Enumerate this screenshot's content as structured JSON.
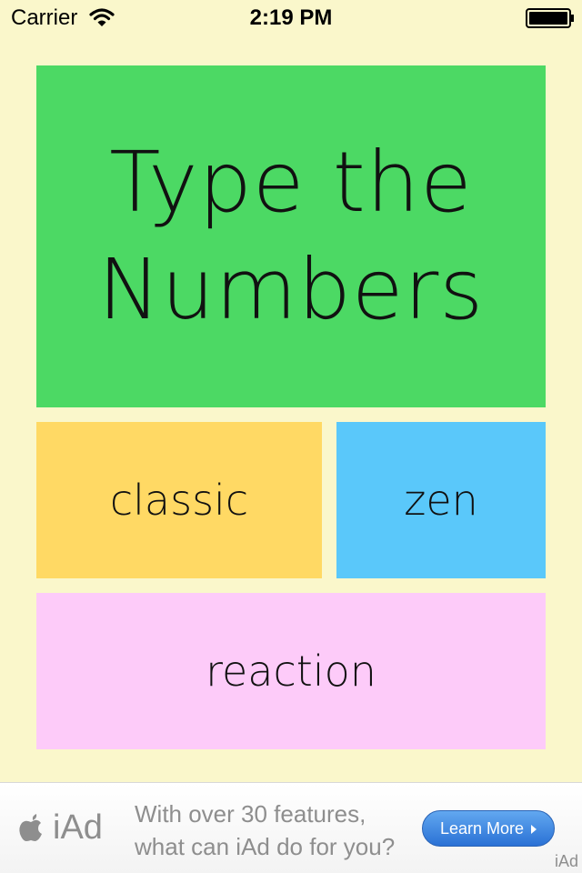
{
  "status_bar": {
    "carrier": "Carrier",
    "time": "2:19 PM",
    "icons": [
      "wifi-icon",
      "battery-icon"
    ]
  },
  "title_tile": {
    "lines": [
      "Type the",
      "Numbers"
    ],
    "color": "#4CD964"
  },
  "modes": {
    "classic": {
      "label": "classic",
      "color": "#FFD964"
    },
    "zen": {
      "label": "zen",
      "color": "#5AC8FA"
    },
    "reaction": {
      "label": "reaction",
      "color": "#FDCBF9"
    }
  },
  "ad_banner": {
    "brand": "iAd",
    "message_lines": [
      "With over 30 features,",
      "what can iAd do for you?"
    ],
    "button_label": "Learn More",
    "corner_label": "iAd",
    "icons": [
      "apple-icon",
      "chevron-right-icon"
    ]
  },
  "colors": {
    "background": "#FAF7CB",
    "button_blue": "#2A71D5"
  }
}
